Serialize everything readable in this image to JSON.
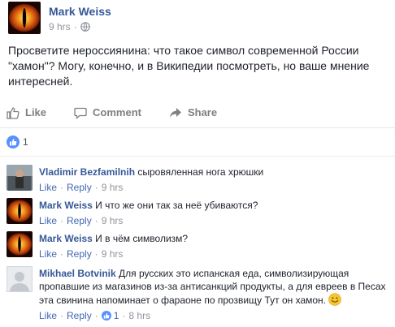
{
  "post": {
    "author": "Mark Weiss",
    "time": "9 hrs",
    "dot": "·",
    "text": "Просветите нероссиянина: что такое символ современной России \"хамон\"? Могу, конечно, и в Википедии посмотреть, но ваше мнение интересней."
  },
  "actions": {
    "like": "Like",
    "comment": "Comment",
    "share": "Share"
  },
  "reactions": {
    "count": "1"
  },
  "comments": [
    {
      "author": "Vladimir Bezfamilnih",
      "text": "сыровяленная нога хрюшки",
      "like": "Like",
      "reply": "Reply",
      "time": "9 hrs",
      "avatar": "photo"
    },
    {
      "author": "Mark Weiss",
      "text": "И что же они так за неё убиваются?",
      "like": "Like",
      "reply": "Reply",
      "time": "9 hrs",
      "avatar": "eye"
    },
    {
      "author": "Mark Weiss",
      "text": "И в чём символизм?",
      "like": "Like",
      "reply": "Reply",
      "time": "9 hrs",
      "avatar": "eye"
    },
    {
      "author": "Mikhael Botvinik",
      "text": "Для русских это испанская еда, символизирующая пропавшие из магазинов из-за антисанкций продукты, а для евреев в Песах эта свинина напоминает о фараоне по прозвищу Тут он хамон.",
      "like": "Like",
      "reply": "Reply",
      "likes": "1",
      "time": "8 hrs",
      "avatar": "blank"
    }
  ],
  "sep": "·",
  "colors": {
    "link": "#365899",
    "meta": "#90949c",
    "like_blue": "#5890ff",
    "action_gray": "#7f7f7f"
  }
}
